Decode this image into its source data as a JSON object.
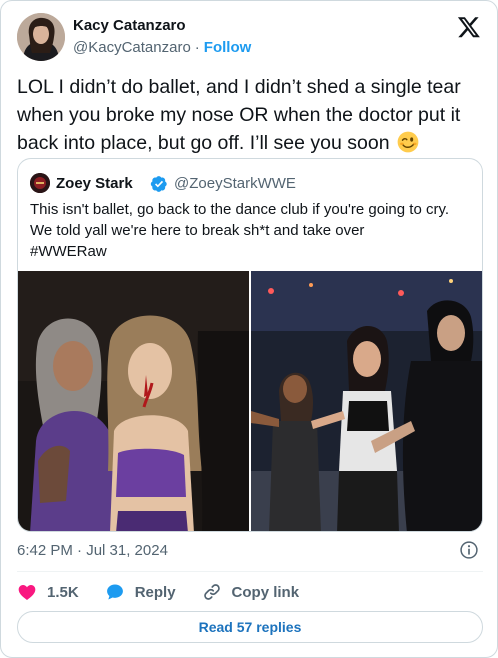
{
  "author": {
    "name": "Kacy Catanzaro",
    "handle": "@KacyCatanzaro",
    "separator": "·",
    "follow_label": "Follow"
  },
  "tweet": {
    "text": "LOL I didn’t do ballet, and I didn’t shed a single tear when you broke my nose OR when the doctor put it back into place, but go off. I’ll see you soon",
    "emoji": "winking-face"
  },
  "quoted_tweet": {
    "name": "Zoey Stark",
    "handle": "@ZoeyStarkWWE",
    "verified": true,
    "text_lines": [
      "This isn't ballet, go back to the dance club if you're going to cry.",
      "We told yall we're here to break sh*t and take over",
      "#WWERaw"
    ],
    "media_count": 2
  },
  "meta": {
    "timestamp": "6:42 PM · Jul 31, 2024"
  },
  "actions": {
    "like_count": "1.5K",
    "reply_label": "Reply",
    "copy_link_label": "Copy link"
  },
  "read_replies_label": "Read 57 replies",
  "colors": {
    "accent": "#1d9bf0",
    "like": "#f91880",
    "text_primary": "#0f1419",
    "text_secondary": "#536471",
    "border": "#cfd9de"
  }
}
